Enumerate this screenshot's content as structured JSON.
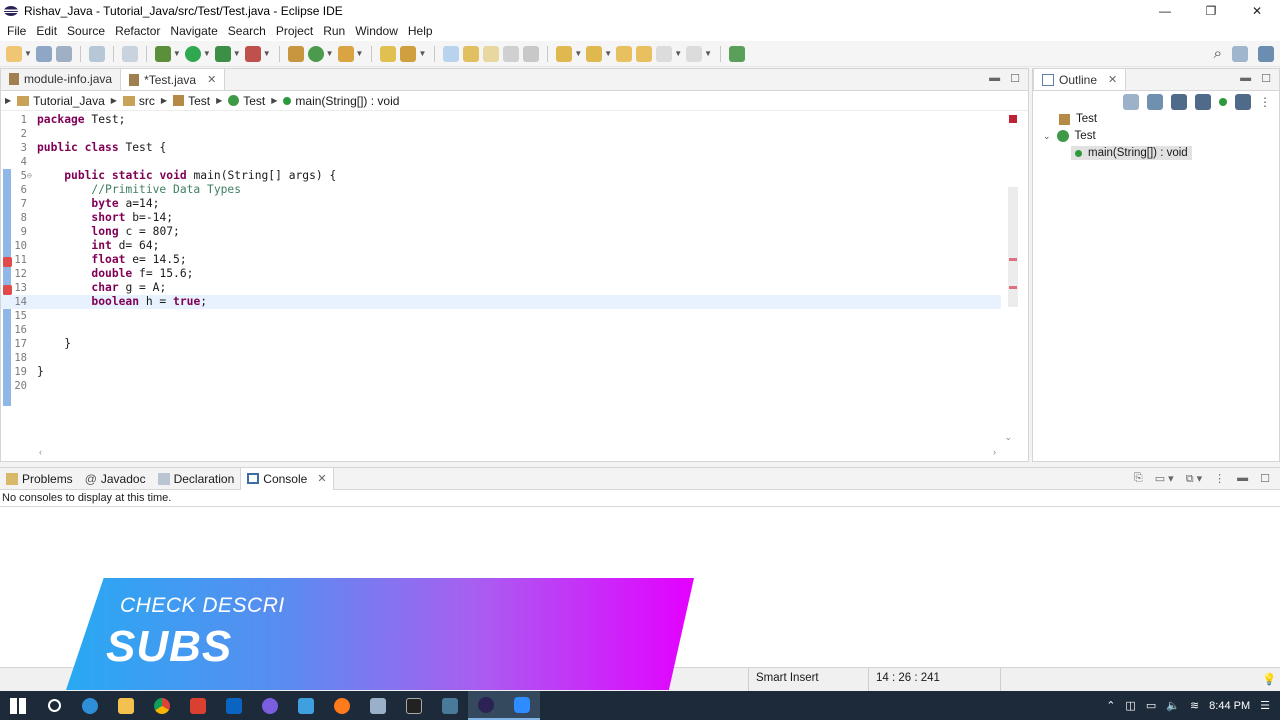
{
  "window": {
    "title": "Rishav_Java - Tutorial_Java/src/Test/Test.java - Eclipse IDE",
    "controls": [
      "—",
      "❐",
      "✕"
    ]
  },
  "menu": [
    "File",
    "Edit",
    "Source",
    "Refactor",
    "Navigate",
    "Search",
    "Project",
    "Run",
    "Window",
    "Help"
  ],
  "editor": {
    "tabs": [
      {
        "label": "module-info.java",
        "active": false
      },
      {
        "label": "*Test.java",
        "active": true
      }
    ],
    "breadcrumb": [
      "Tutorial_Java",
      "src",
      "Test",
      "Test",
      "main(String[]) : void"
    ],
    "lines": [
      {
        "n": "1",
        "text": "package Test;"
      },
      {
        "n": "2",
        "text": ""
      },
      {
        "n": "3",
        "text": "public class Test {"
      },
      {
        "n": "4",
        "text": ""
      },
      {
        "n": "5",
        "text": "    public static void main(String[] args) {"
      },
      {
        "n": "6",
        "text": "        //Primitive Data Types"
      },
      {
        "n": "7",
        "text": "        byte a=14;"
      },
      {
        "n": "8",
        "text": "        short b=-14;"
      },
      {
        "n": "9",
        "text": "        long c = 807;"
      },
      {
        "n": "10",
        "text": "        int d= 64;"
      },
      {
        "n": "11",
        "text": "        float e= 14.5;"
      },
      {
        "n": "12",
        "text": "        double f= 15.6;"
      },
      {
        "n": "13",
        "text": "        char g = A;"
      },
      {
        "n": "14",
        "text": "        boolean h = true;"
      },
      {
        "n": "15",
        "text": ""
      },
      {
        "n": "16",
        "text": ""
      },
      {
        "n": "17",
        "text": "    }"
      },
      {
        "n": "18",
        "text": ""
      },
      {
        "n": "19",
        "text": "}"
      },
      {
        "n": "20",
        "text": ""
      }
    ]
  },
  "outline": {
    "tab_label": "Outline",
    "items": [
      {
        "label": "Test",
        "kind": "package"
      },
      {
        "label": "Test",
        "kind": "class"
      },
      {
        "label": "main(String[]) : void",
        "kind": "method"
      }
    ]
  },
  "bottom_panel": {
    "tabs": [
      "Problems",
      "Javadoc",
      "Declaration",
      "Console"
    ],
    "active_tab": "Console",
    "console_message": "No consoles to display at this time."
  },
  "statusbar": {
    "mode": "Smart Insert",
    "position": "14 : 26 : 241"
  },
  "overlay": {
    "line1": "CHECK DESCRI",
    "line2": "SUBS"
  },
  "taskbar": {
    "time": "8:44 PM"
  },
  "colors": {
    "keyword": "#7f0055",
    "comment": "#3f7f5f",
    "current_line": "#e8f2fe",
    "taskbar": "#1c2a3a"
  }
}
